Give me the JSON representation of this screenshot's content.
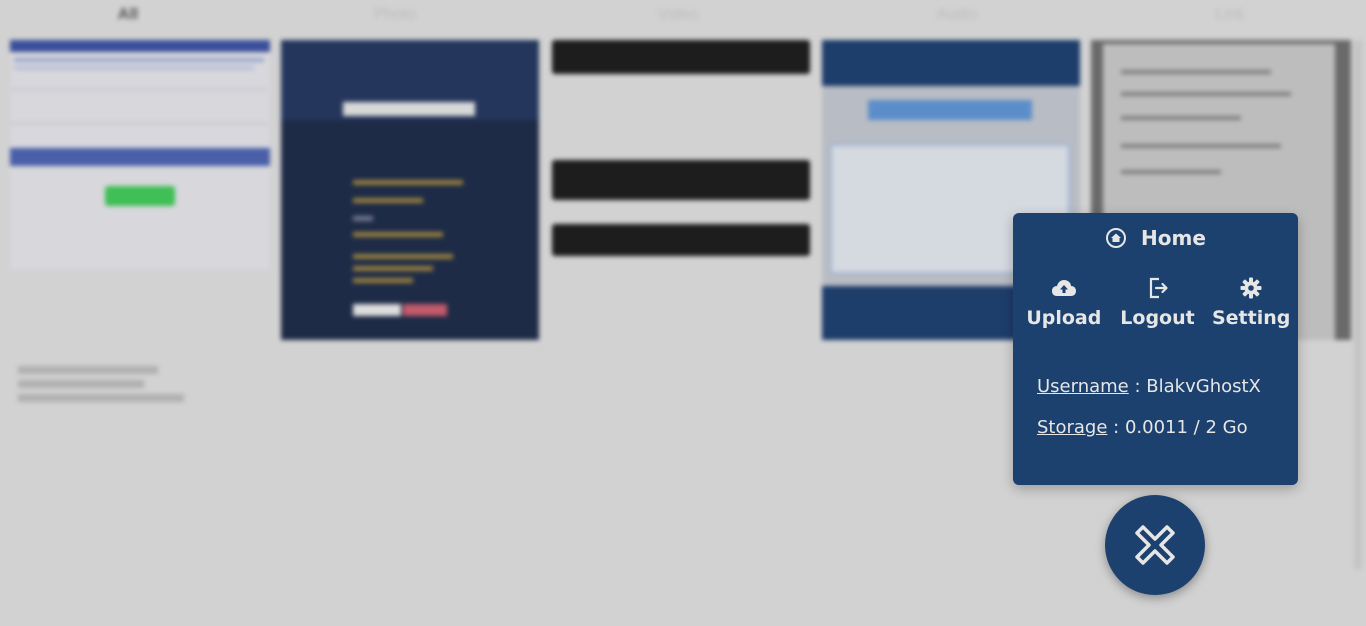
{
  "tabs": [
    {
      "label": "All",
      "active": true
    },
    {
      "label": "Photo",
      "active": false
    },
    {
      "label": "Video",
      "active": false
    },
    {
      "label": "Audio",
      "active": false
    },
    {
      "label": "Link",
      "active": false
    }
  ],
  "menu": {
    "home_label": "Home",
    "actions": {
      "upload": "Upload",
      "logout": "Logout",
      "setting": "Setting"
    },
    "username_key": "Username",
    "username_value": ": BlakvGhostX",
    "storage_key": "Storage",
    "storage_value": ": 0.0011 / 2 Go"
  },
  "icons": {
    "home": "home-icon",
    "upload": "cloud-upload-icon",
    "logout": "logout-icon",
    "setting": "gear-icon",
    "close": "close-icon"
  },
  "colors": {
    "menu_bg": "#1d416e",
    "menu_text": "#e6e6e6",
    "page_bg": "#d2d2d2"
  }
}
